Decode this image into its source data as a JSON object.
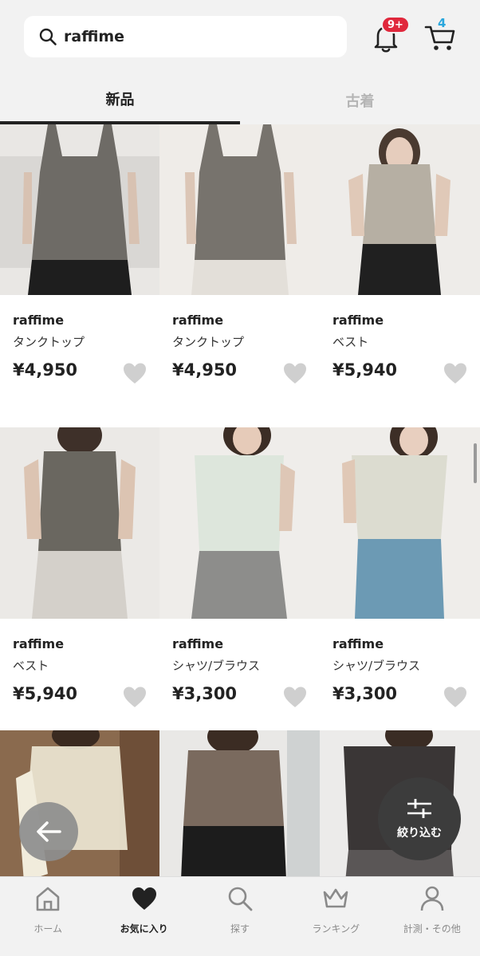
{
  "header": {
    "search_value": "raffime",
    "notification_badge": "9+",
    "cart_count": "4"
  },
  "tabs": [
    {
      "label": "新品",
      "active": true
    },
    {
      "label": "古着",
      "active": false
    }
  ],
  "products": [
    {
      "brand": "raffime",
      "category": "タンクトップ",
      "price": "¥4,950"
    },
    {
      "brand": "raffime",
      "category": "タンクトップ",
      "price": "¥4,950"
    },
    {
      "brand": "raffime",
      "category": "ベスト",
      "price": "¥5,940"
    },
    {
      "brand": "raffime",
      "category": "ベスト",
      "price": "¥5,940"
    },
    {
      "brand": "raffime",
      "category": "シャツ/ブラウス",
      "price": "¥3,300"
    },
    {
      "brand": "raffime",
      "category": "シャツ/ブラウス",
      "price": "¥3,300"
    }
  ],
  "filter_button": {
    "label": "絞り込む"
  },
  "bottom_nav": [
    {
      "label": "ホーム",
      "icon": "home-icon",
      "active": false
    },
    {
      "label": "お気に入り",
      "icon": "heart-icon",
      "active": true
    },
    {
      "label": "探す",
      "icon": "search-icon",
      "active": false
    },
    {
      "label": "ランキング",
      "icon": "crown-icon",
      "active": false
    },
    {
      "label": "計測・その他",
      "icon": "person-icon",
      "active": false
    }
  ],
  "colors": {
    "badge_red": "#e0283c",
    "cart_blue": "#2aa7dd",
    "filter_dark": "#3c3c3c",
    "fav_gray": "#cfcfcf"
  }
}
